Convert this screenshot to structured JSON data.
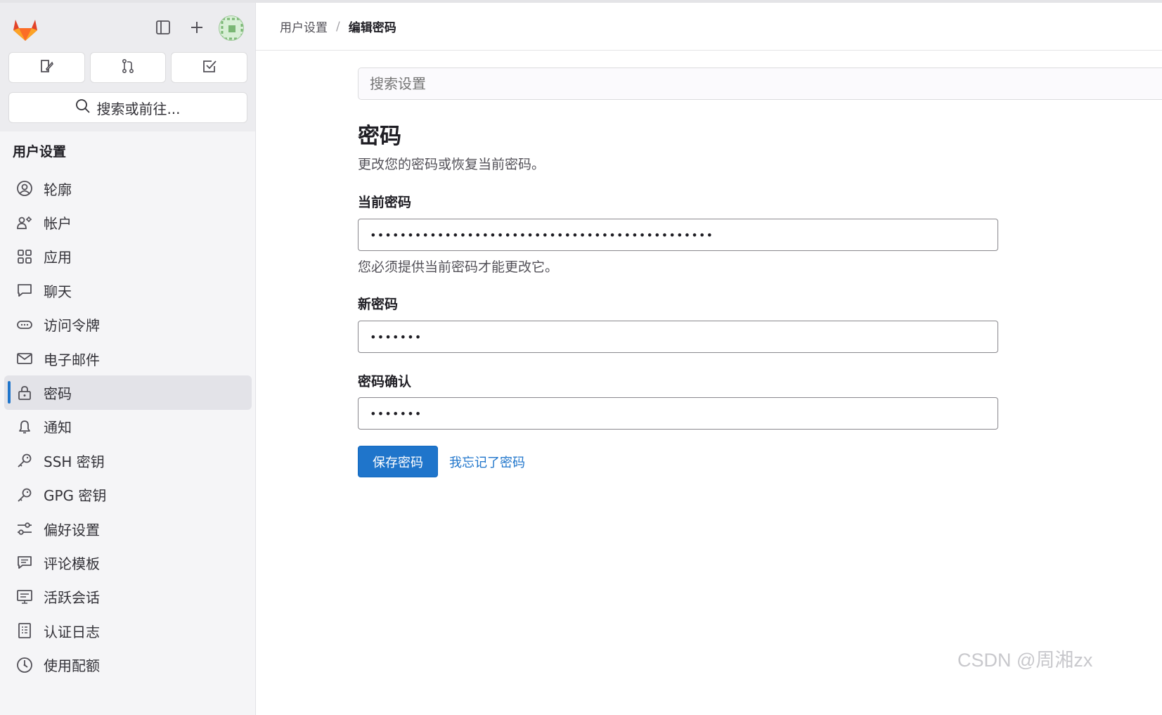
{
  "header": {
    "breadcrumb": [
      "用户设置",
      "编辑密码"
    ],
    "breadcrumb_separator": "/"
  },
  "sidebar": {
    "top_icons": [
      "tanuki-logo-icon",
      "sidebar-toggle-icon",
      "plus-icon",
      "avatar"
    ],
    "quick_actions": [
      "issues-icon",
      "merge-request-icon",
      "todo-icon"
    ],
    "search_label": "搜索或前往...",
    "section_title": "用户设置",
    "items": [
      {
        "label": "轮廓",
        "icon": "profile-icon",
        "active": false
      },
      {
        "label": "帐户",
        "icon": "account-icon",
        "active": false
      },
      {
        "label": "应用",
        "icon": "applications-icon",
        "active": false
      },
      {
        "label": "聊天",
        "icon": "chat-icon",
        "active": false
      },
      {
        "label": "访问令牌",
        "icon": "token-icon",
        "active": false
      },
      {
        "label": "电子邮件",
        "icon": "mail-icon",
        "active": false
      },
      {
        "label": "密码",
        "icon": "lock-icon",
        "active": true
      },
      {
        "label": "通知",
        "icon": "bell-icon",
        "active": false
      },
      {
        "label": "SSH 密钥",
        "icon": "key-icon",
        "active": false
      },
      {
        "label": "GPG 密钥",
        "icon": "key-icon",
        "active": false
      },
      {
        "label": "偏好设置",
        "icon": "preferences-icon",
        "active": false
      },
      {
        "label": "评论模板",
        "icon": "comment-template-icon",
        "active": false
      },
      {
        "label": "活跃会话",
        "icon": "monitor-icon",
        "active": false
      },
      {
        "label": "认证日志",
        "icon": "log-icon",
        "active": false
      },
      {
        "label": "使用配额",
        "icon": "quota-icon",
        "active": false
      }
    ]
  },
  "main": {
    "search_placeholder": "搜索设置",
    "title": "密码",
    "description": "更改您的密码或恢复当前密码。",
    "current_password": {
      "label": "当前密码",
      "value": "••••••••••••••••••••••••••••••••••••••••••••••",
      "help": "您必须提供当前密码才能更改它。"
    },
    "new_password": {
      "label": "新密码",
      "value": "•••••••"
    },
    "confirm_password": {
      "label": "密码确认",
      "value": "•••••••"
    },
    "save_label": "保存密码",
    "forgot_label": "我忘记了密码"
  },
  "watermark": "CSDN @周湘zx",
  "colors": {
    "primary": "#1f75cb",
    "sidebar_bg": "#f5f5f7",
    "active_item_bg": "#e3e3e8"
  }
}
